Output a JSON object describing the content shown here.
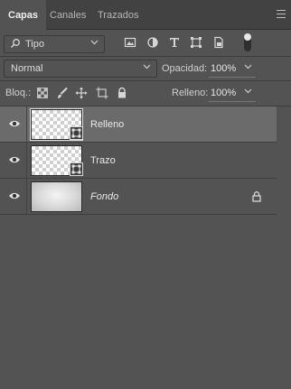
{
  "tabs": [
    {
      "label": "Capas"
    },
    {
      "label": "Canales"
    },
    {
      "label": "Trazados"
    }
  ],
  "filter": {
    "label": "Tipo"
  },
  "blend_mode": {
    "value": "Normal"
  },
  "opacity": {
    "label": "Opacidad:",
    "value": "100%"
  },
  "lock": {
    "label": "Bloq.:"
  },
  "fill": {
    "label": "Relleno:",
    "value": "100%"
  },
  "layers": [
    {
      "name": "Relleno",
      "selected": true
    },
    {
      "name": "Trazo",
      "selected": false
    },
    {
      "name": "Fondo",
      "selected": false,
      "locked": true
    }
  ]
}
